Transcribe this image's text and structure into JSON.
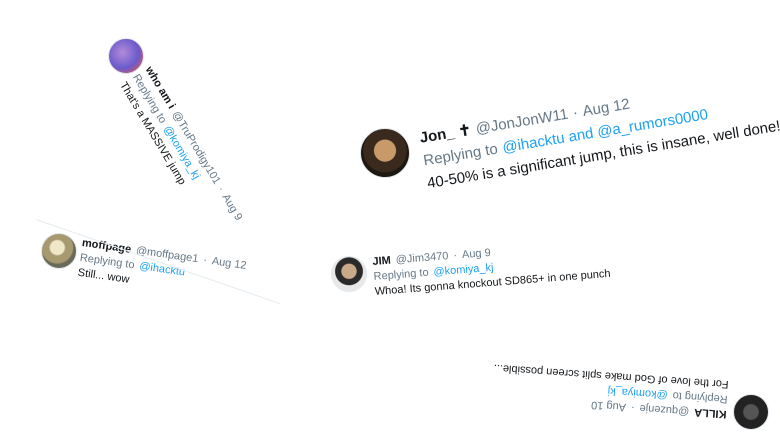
{
  "tweets": [
    {
      "display_name": "who am i",
      "handle": "@TruProdigy101",
      "sep": "·",
      "date": "Aug 9",
      "reply_prefix": "Replying to",
      "reply_to": "@komiya_kj",
      "body": "That's a MASSIVE jump"
    },
    {
      "display_name": "Jon_ ✝",
      "handle": "@JonJonW11",
      "sep": "·",
      "date": "Aug 12",
      "reply_prefix": "Replying to",
      "reply_to": "@ihacktu and @a_rumors0000",
      "body": "40-50% is a significant jump, this is insane, well done!"
    },
    {
      "display_name": "moffpage",
      "handle": "@moffpage1",
      "sep": "·",
      "date": "Aug 12",
      "reply_prefix": "Replying to",
      "reply_to": "@ihacktu",
      "body": "Still... wow"
    },
    {
      "display_name": "JIM",
      "handle": "@Jim3470",
      "sep": "·",
      "date": "Aug 9",
      "reply_prefix": "Replying to",
      "reply_to": "@komiya_kj",
      "body": "Whoa! Its gonna knockout SD865+ in one punch"
    },
    {
      "display_name": "KILLA",
      "handle": "@quzenje",
      "sep": "·",
      "date": "Aug 10",
      "reply_prefix": "Replying to",
      "reply_to": "@komiya_kj",
      "body": "For the love of God make split screen possible..."
    }
  ]
}
